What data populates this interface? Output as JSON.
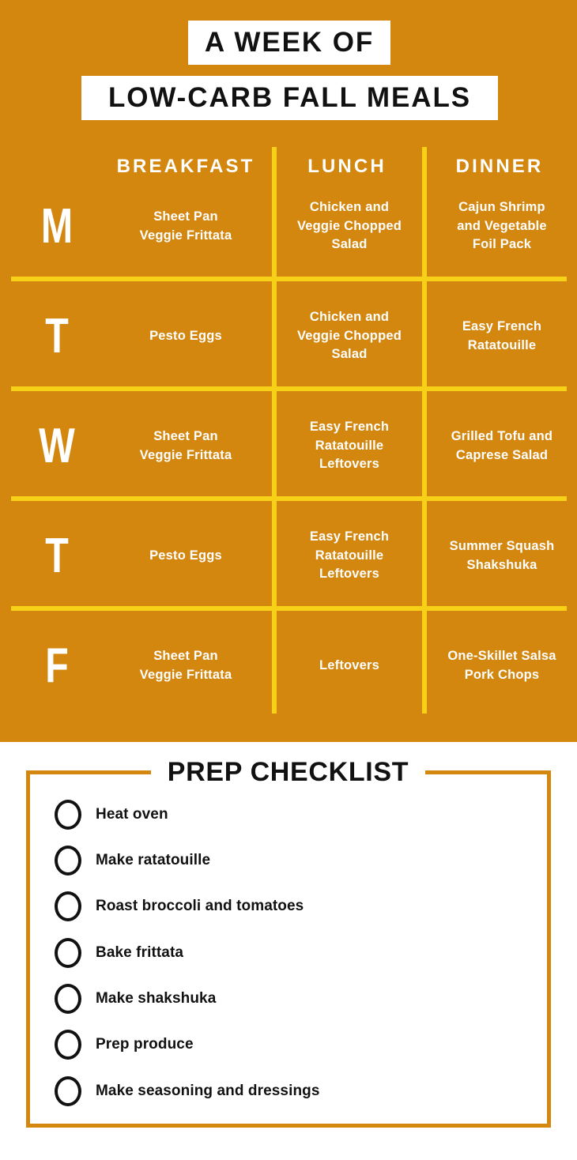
{
  "title": {
    "line1": "A WEEK OF",
    "line2": "LOW-CARB FALL MEALS"
  },
  "colors": {
    "panel_orange": "#D4870F",
    "rule_yellow": "#F7D117",
    "text_white": "#FFFFFF",
    "text_black": "#111111",
    "page_white": "#FFFFFF"
  },
  "meal_table": {
    "columns": [
      "BREAKFAST",
      "LUNCH",
      "DINNER"
    ],
    "rows": [
      {
        "day_letter": "M",
        "breakfast": "Sheet Pan\nVeggie Frittata",
        "lunch": "Chicken and\nVeggie Chopped\nSalad",
        "dinner": "Cajun Shrimp\nand Vegetable\nFoil Pack"
      },
      {
        "day_letter": "T",
        "breakfast": "Pesto Eggs",
        "lunch": "Chicken and\nVeggie Chopped\nSalad",
        "dinner": "Easy French\nRatatouille"
      },
      {
        "day_letter": "W",
        "breakfast": "Sheet Pan\nVeggie Frittata",
        "lunch": "Easy French\nRatatouille\nLeftovers",
        "dinner": "Grilled Tofu and\nCaprese Salad"
      },
      {
        "day_letter": "T",
        "breakfast": "Pesto Eggs",
        "lunch": "Easy French\nRatatouille\nLeftovers",
        "dinner": "Summer Squash\nShakshuka"
      },
      {
        "day_letter": "F",
        "breakfast": "Sheet Pan\nVeggie Frittata",
        "lunch": "Leftovers",
        "dinner": "One-Skillet Salsa\nPork Chops"
      }
    ]
  },
  "checklist": {
    "title": "PREP CHECKLIST",
    "items": [
      {
        "label": "Heat oven",
        "checked": false
      },
      {
        "label": "Make ratatouille",
        "checked": false
      },
      {
        "label": "Roast broccoli and tomatoes",
        "checked": false
      },
      {
        "label": "Bake frittata",
        "checked": false
      },
      {
        "label": "Make shakshuka",
        "checked": false
      },
      {
        "label": "Prep produce",
        "checked": false
      },
      {
        "label": "Make seasoning and dressings",
        "checked": false
      }
    ]
  }
}
